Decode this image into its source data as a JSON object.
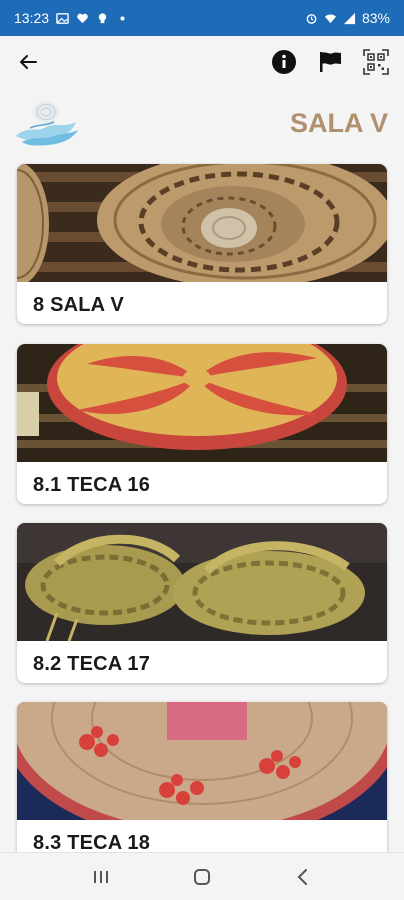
{
  "status_bar": {
    "time": "13:23",
    "battery": "83%",
    "left_icons": [
      "gallery-icon",
      "heart-icon",
      "lightbulb-icon",
      "dot-icon"
    ],
    "right_icons": [
      "alarm-icon",
      "wifi-icon",
      "signal-icon"
    ]
  },
  "app_bar": {
    "back_icon": "arrow-left-icon",
    "actions": [
      "info-icon",
      "flag-icon",
      "qr-code-icon"
    ]
  },
  "header": {
    "title": "SALA V",
    "logo": "museum-logo"
  },
  "items": [
    {
      "label": "8 SALA V",
      "image": "round-straw-basket"
    },
    {
      "label": "8.1 TECA 16",
      "image": "red-yellow-spiral-basket"
    },
    {
      "label": "8.2 TECA 17",
      "image": "woven-straw-sandals"
    },
    {
      "label": "8.3 TECA 18",
      "image": "red-pattern-basket"
    }
  ],
  "nav_bar": {
    "buttons": [
      "recents-icon",
      "home-icon",
      "back-chevron-icon"
    ]
  },
  "colors": {
    "status_bar_bg": "#1e6bb8",
    "title_color": "#b0906e",
    "page_bg": "#f4f4f4"
  }
}
